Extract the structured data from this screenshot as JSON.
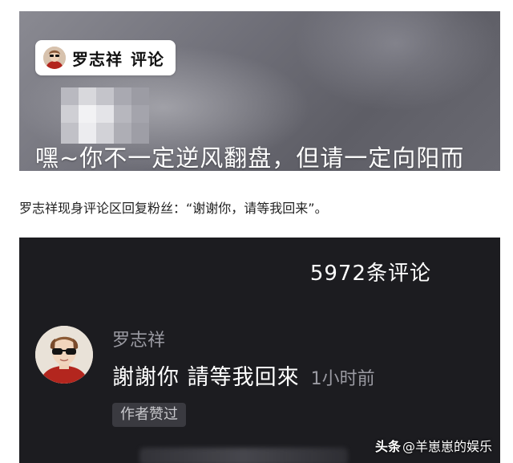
{
  "top_screenshot": {
    "chip_name": "罗志祥",
    "chip_label": "评论",
    "caption": "嘿~你不一定逆风翻盘，但请一定向阳而"
  },
  "article": {
    "paragraph": "罗志祥现身评论区回复粉丝：“谢谢你，请等我回来”。"
  },
  "bottom_screenshot": {
    "comment_count": "5972条评论",
    "author": "罗志祥",
    "comment_text": "謝謝你 請等我回來",
    "time": "1小时前",
    "badge": "作者赞过"
  },
  "watermark": {
    "brand": "头条",
    "handle": "@羊崽崽的娱乐"
  }
}
